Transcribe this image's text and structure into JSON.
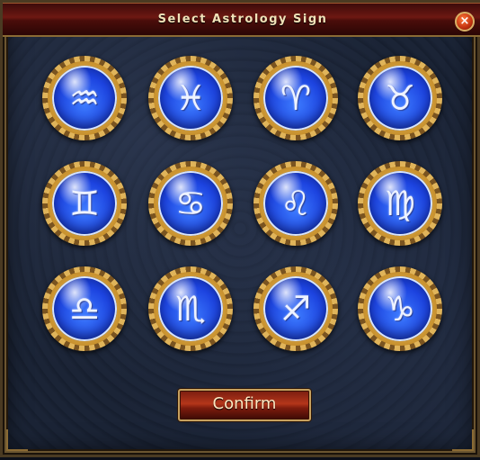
{
  "dialog": {
    "title": "Select Astrology Sign",
    "close_label": "×",
    "confirm_label": "Confirm"
  },
  "signs": [
    {
      "name": "Aquarius",
      "glyph": "♒"
    },
    {
      "name": "Pisces",
      "glyph": "♓"
    },
    {
      "name": "Aries",
      "glyph": "♈"
    },
    {
      "name": "Taurus",
      "glyph": "♉"
    },
    {
      "name": "Gemini",
      "glyph": "♊"
    },
    {
      "name": "Cancer",
      "glyph": "♋"
    },
    {
      "name": "Leo",
      "glyph": "♌"
    },
    {
      "name": "Virgo",
      "glyph": "♍"
    },
    {
      "name": "Libra",
      "glyph": "♎"
    },
    {
      "name": "Scorpio",
      "glyph": "♏"
    },
    {
      "name": "Sagittarius",
      "glyph": "♐"
    },
    {
      "name": "Capricorn",
      "glyph": "♑"
    }
  ],
  "colors": {
    "orb": "#1d44e0",
    "frame": "#c8912e",
    "title_bar": "#6d1812",
    "confirm_button": "#b4361a"
  }
}
